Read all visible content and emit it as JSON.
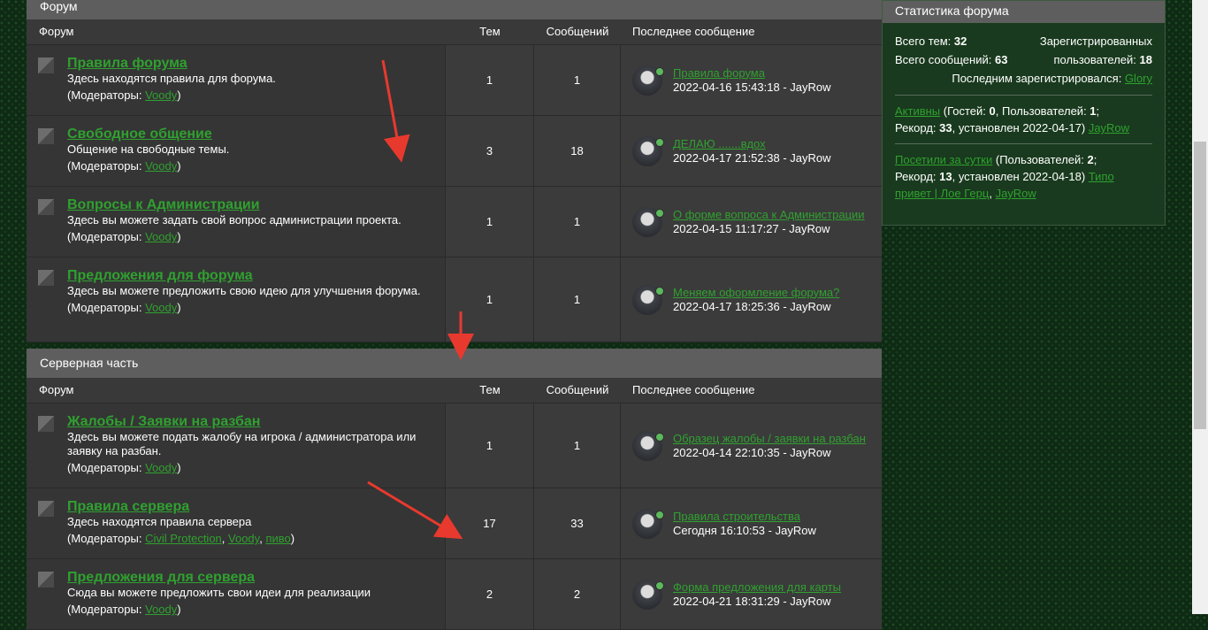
{
  "forum_section": {
    "title": "Форум",
    "headers": {
      "forum": "Форум",
      "topics": "Тем",
      "messages": "Сообщений",
      "last": "Последнее сообщение"
    },
    "rows": [
      {
        "title": "Правила форума",
        "desc": "Здесь находятся правила для форума.",
        "mods_label": "(Модераторы: ",
        "mods": [
          "Voody"
        ],
        "topics": "1",
        "messages": "1",
        "last_link": "Правила форума",
        "last_date": "2022-04-16 15:43:18 - JayRow"
      },
      {
        "title": "Свободное общение",
        "desc": "Общение на свободные темы.",
        "mods_label": "(Модераторы: ",
        "mods": [
          "Voody"
        ],
        "topics": "3",
        "messages": "18",
        "last_link": "ДЕЛАЮ .......вдох",
        "last_date": "2022-04-17 21:52:38 - JayRow"
      },
      {
        "title": "Вопросы к Администрации",
        "desc": "Здесь вы можете задать свой вопрос администрации проекта.",
        "mods_label": "(Модераторы: ",
        "mods": [
          "Voody"
        ],
        "topics": "1",
        "messages": "1",
        "last_link": "О форме вопроса к Администрации",
        "last_date": "2022-04-15 11:17:27 - JayRow"
      },
      {
        "title": "Предложения для форума",
        "desc": "Здесь вы можете предложить свою идею для улучшения форума.",
        "mods_label": "(Модераторы: ",
        "mods": [
          "Voody"
        ],
        "topics": "1",
        "messages": "1",
        "last_link": "Меняем оформление форума?",
        "last_date": "2022-04-17 18:25:36 - JayRow"
      }
    ]
  },
  "server_section": {
    "title": "Серверная часть",
    "headers": {
      "forum": "Форум",
      "topics": "Тем",
      "messages": "Сообщений",
      "last": "Последнее сообщение"
    },
    "rows": [
      {
        "title": "Жалобы / Заявки на разбан",
        "desc": "Здесь вы можете подать жалобу на игрока / администратора или заявку на разбан.",
        "mods_label": "(Модераторы: ",
        "mods": [
          "Voody"
        ],
        "topics": "1",
        "messages": "1",
        "last_link": "Образец жалобы / заявки на разбан",
        "last_date": "2022-04-14 22:10:35 - JayRow"
      },
      {
        "title": "Правила сервера",
        "desc": "Здесь находятся правила сервера",
        "mods_label": "(Модераторы: ",
        "mods": [
          "Civil Protection",
          "Voody",
          "пиво"
        ],
        "topics": "17",
        "messages": "33",
        "last_link": "Правила строительства",
        "last_date": "Сегодня 16:10:53 - JayRow"
      },
      {
        "title": "Предложения для сервера",
        "desc": "Сюда вы можете предложить свои идеи для реализации",
        "mods_label": "(Модераторы: ",
        "mods": [
          "Voody"
        ],
        "topics": "2",
        "messages": "2",
        "last_link": "Форма предложения для карты",
        "last_date": "2022-04-21 18:31:29 - JayRow"
      }
    ]
  },
  "stats": {
    "title": "Статистика форума",
    "total_topics_label": "Всего тем:",
    "total_topics": "32",
    "registered_label": "Зарегистрированных",
    "total_msgs_label": "Всего сообщений:",
    "total_msgs": "63",
    "users_label": "пользователей:",
    "users": "18",
    "last_reg_label": "Последним зарегистрировался:",
    "last_reg": "Glory",
    "active_link": "Активны",
    "active_text_1": " (Гостей: ",
    "guests": "0",
    "active_text_2": ", Пользователей: ",
    "active_users": "1",
    "active_text_3": ";",
    "record_label": "Рекорд: ",
    "record_active": "33",
    "record_active_text": ", установлен 2022-04-17)",
    "active_user_link": "JayRow",
    "visited_link": "Посетили за сутки",
    "visited_text_1": " (Пользователей: ",
    "visited_users": "2",
    "visited_text_2": ";",
    "record_visited": "13",
    "record_visited_text": ", установлен 2022-04-18)",
    "visited_user_1": "Типо привет | Лое Герц",
    "visited_user_2": "JayRow"
  }
}
